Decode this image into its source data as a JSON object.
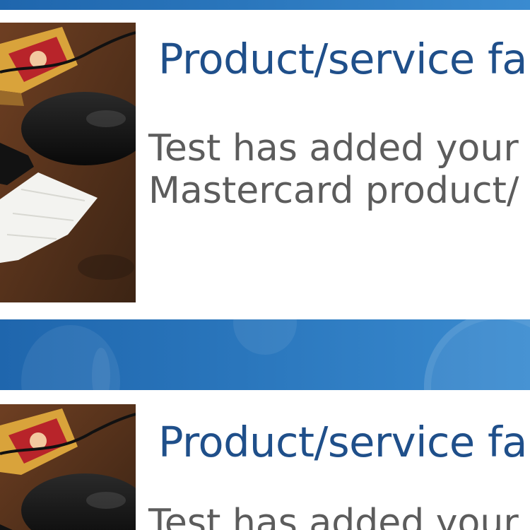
{
  "cards": [
    {
      "title": "Product/service fa",
      "desc_line1": "Test has added your S",
      "desc_line2": "Mastercard product/"
    },
    {
      "title": "Product/service fa",
      "desc_line1": "Test has added your",
      "desc_line2": ""
    }
  ],
  "colors": {
    "band": "#2a76bc",
    "title": "#1f4f8a",
    "desc": "#5c5c5c"
  }
}
